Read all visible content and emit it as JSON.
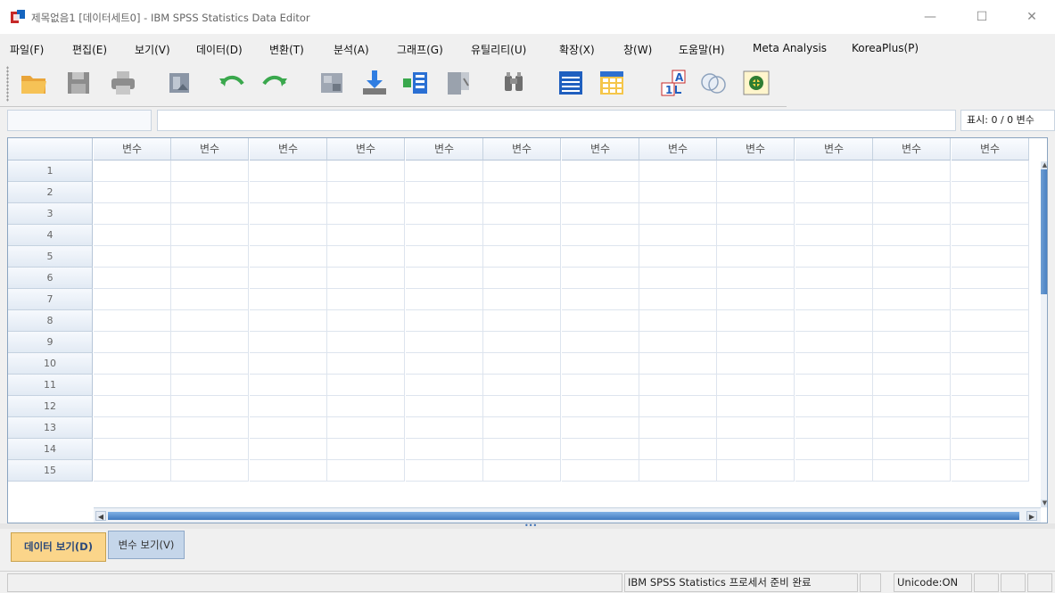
{
  "titlebar": {
    "title": "제목없음1 [데이터세트0] - IBM SPSS Statistics Data Editor",
    "minimize_glyph": "—",
    "maximize_glyph": "☐",
    "close_glyph": "✕"
  },
  "menu": [
    "파일(F)",
    "편집(E)",
    "보기(V)",
    "데이터(D)",
    "변환(T)",
    "분석(A)",
    "그래프(G)",
    "유틸리티(U)",
    "확장(X)",
    "창(W)",
    "도움말(H)",
    "Meta Analysis",
    "KoreaPlus(P)"
  ],
  "toolbar": {
    "icons": [
      "open-folder-icon",
      "save-icon",
      "print-icon",
      "recall-dialog-icon",
      "undo-icon",
      "redo-icon",
      "goto-case-icon",
      "goto-variable-icon",
      "variables-icon",
      "run-descriptives-icon",
      "find-icon",
      "insert-cases-icon",
      "insert-variable-icon",
      "value-labels-icon",
      "use-variable-sets-icon",
      "spelling-icon"
    ]
  },
  "editor": {
    "cell_name": "",
    "cell_value": "",
    "display_count": "표시: 0 / 0 변수"
  },
  "grid": {
    "column_header": "변수",
    "row_numbers": [
      "1",
      "2",
      "3",
      "4",
      "5",
      "6",
      "7",
      "8",
      "9",
      "10",
      "11",
      "12",
      "13",
      "14",
      "15"
    ]
  },
  "tabs": {
    "data_view": "데이터 보기(D)",
    "variable_view": "변수 보기(V)"
  },
  "statusbar": {
    "processor_status": "IBM SPSS Statistics 프로세서 준비 완료",
    "unicode": "Unicode:ON"
  },
  "colors": {
    "active_tab": "#fbd58a",
    "inactive_tab": "#c5d6ea",
    "scroll_thumb": "#3f79bf"
  }
}
